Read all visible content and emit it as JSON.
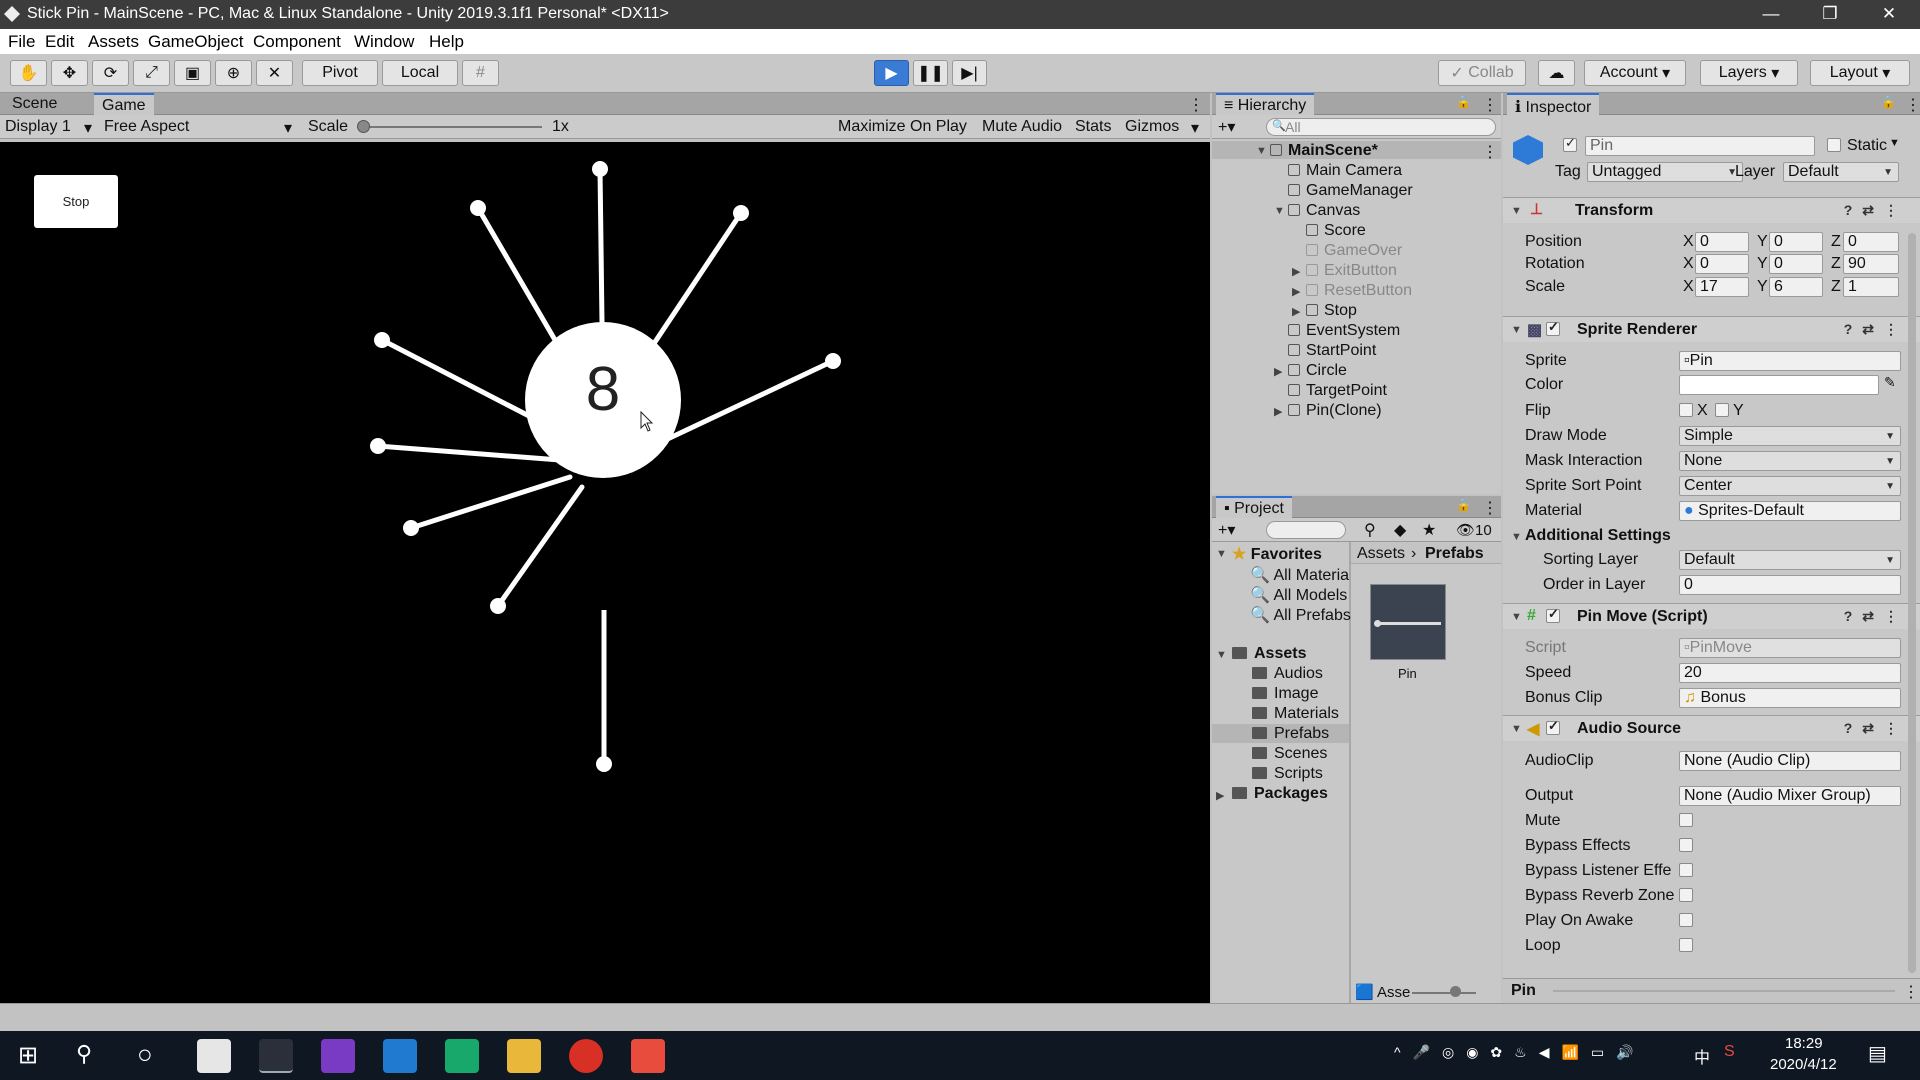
{
  "window": {
    "title": "Stick Pin - MainScene - PC, Mac & Linux Standalone - Unity 2019.3.1f1 Personal* <DX11>",
    "minimize": "—",
    "maximize": "❐",
    "close": "✕"
  },
  "menu": [
    "File",
    "Edit",
    "Assets",
    "GameObject",
    "Component",
    "Window",
    "Help"
  ],
  "toolbar": {
    "pivot": "Pivot",
    "local": "Local",
    "collab": "Collab",
    "account": "Account",
    "layers": "Layers",
    "layout": "Layout"
  },
  "game_tabs": {
    "scene": "Scene",
    "game": "Game"
  },
  "game_bar": {
    "display": "Display 1",
    "aspect": "Free Aspect",
    "scale_label": "Scale",
    "scale_value": "1x",
    "maximize": "Maximize On Play",
    "mute": "Mute Audio",
    "stats": "Stats",
    "gizmos": "Gizmos"
  },
  "game": {
    "stop_button": "Stop",
    "score": "8",
    "pin_count_attached": 10
  },
  "hierarchy": {
    "title": "Hierarchy",
    "search_placeholder": "All",
    "items": [
      {
        "label": "MainScene*"
      },
      {
        "label": "Main Camera"
      },
      {
        "label": "GameManager"
      },
      {
        "label": "Canvas"
      },
      {
        "label": "Score"
      },
      {
        "label": "GameOver"
      },
      {
        "label": "ExitButton"
      },
      {
        "label": "ResetButton"
      },
      {
        "label": "Stop"
      },
      {
        "label": "EventSystem"
      },
      {
        "label": "StartPoint"
      },
      {
        "label": "Circle"
      },
      {
        "label": "TargetPoint"
      },
      {
        "label": "Pin(Clone)"
      }
    ]
  },
  "project": {
    "title": "Project",
    "count": "10",
    "favorites": "Favorites",
    "fav_items": [
      "All Materia",
      "All Models",
      "All Prefabs"
    ],
    "assets": "Assets",
    "folders": [
      "Audios",
      "Image",
      "Materials",
      "Prefabs",
      "Scenes",
      "Scripts"
    ],
    "packages": "Packages",
    "breadcrumb": [
      "Assets",
      "Prefabs"
    ],
    "asset_name": "Pin",
    "bottom_label": "Asse"
  },
  "inspector": {
    "title": "Inspector",
    "object_name": "Pin",
    "static": "Static",
    "tag_label": "Tag",
    "tag_value": "Untagged",
    "layer_label": "Layer",
    "layer_value": "Default",
    "transform": {
      "title": "Transform",
      "position": "Position",
      "rotation": "Rotation",
      "scale": "Scale",
      "pos": [
        "0",
        "0",
        "0"
      ],
      "rot": [
        "0",
        "0",
        "90"
      ],
      "scl": [
        "17",
        "6",
        "1"
      ]
    },
    "sprite_renderer": {
      "title": "Sprite Renderer",
      "sprite": "Sprite",
      "sprite_value": "Pin",
      "color": "Color",
      "flip": "Flip",
      "flip_x": "X",
      "flip_y": "Y",
      "draw_mode": "Draw Mode",
      "draw_mode_value": "Simple",
      "mask": "Mask Interaction",
      "mask_value": "None",
      "sort_point": "Sprite Sort Point",
      "sort_point_value": "Center",
      "material": "Material",
      "material_value": "Sprites-Default",
      "additional": "Additional Settings",
      "sorting_layer": "Sorting Layer",
      "sorting_layer_value": "Default",
      "order": "Order in Layer",
      "order_value": "0"
    },
    "pin_move": {
      "title": "Pin Move (Script)",
      "script": "Script",
      "script_value": "PinMove",
      "speed": "Speed",
      "speed_value": "20",
      "bonus": "Bonus Clip",
      "bonus_value": "Bonus"
    },
    "audio": {
      "title": "Audio Source",
      "clip": "AudioClip",
      "clip_value": "None (Audio Clip)",
      "output": "Output",
      "output_value": "None (Audio Mixer Group)",
      "mute": "Mute",
      "bypass_effects": "Bypass Effects",
      "bypass_listener": "Bypass Listener Effe",
      "bypass_reverb": "Bypass Reverb Zone",
      "play_on_awake": "Play On Awake",
      "loop": "Loop"
    },
    "footer": "Pin"
  },
  "taskbar": {
    "time": "18:29",
    "date": "2020/4/12",
    "ime": "中"
  },
  "colors": {
    "play_active": "#3a7bd5",
    "game_bg": "#000000",
    "selection": "#b5b5b5"
  }
}
